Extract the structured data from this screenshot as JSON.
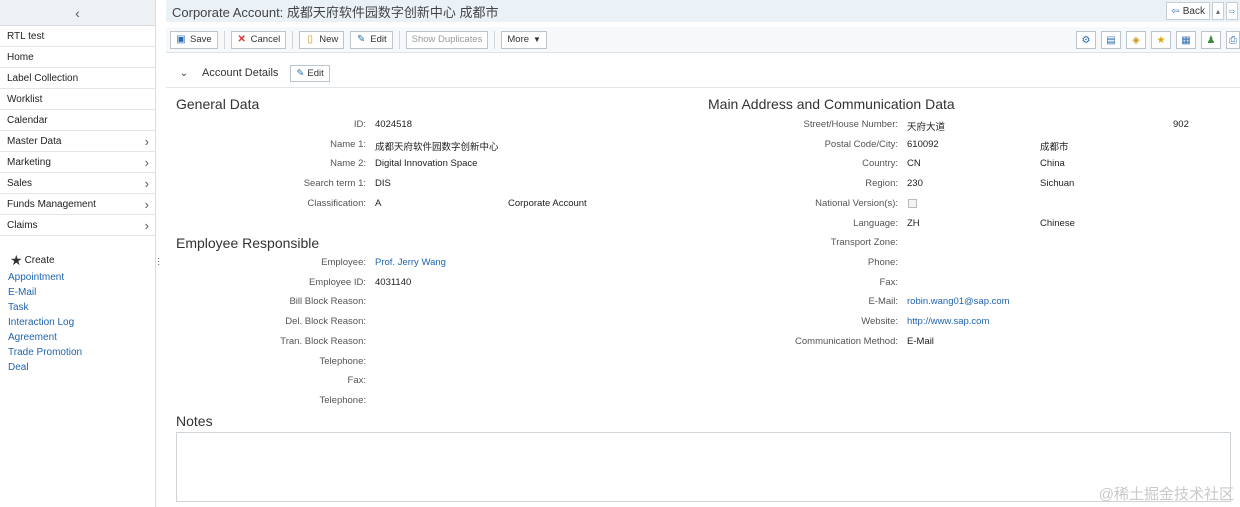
{
  "window": {
    "title": "Corporate Account: 成都天府软件园数字创新中心 成都市",
    "back_label": "Back"
  },
  "sidebar": {
    "items": [
      {
        "label": "RTL test",
        "has_sub": false
      },
      {
        "label": "Home",
        "has_sub": false
      },
      {
        "label": "Label Collection",
        "has_sub": false
      },
      {
        "label": "Worklist",
        "has_sub": false
      },
      {
        "label": "Calendar",
        "has_sub": false
      },
      {
        "label": "Master Data",
        "has_sub": true
      },
      {
        "label": "Marketing",
        "has_sub": true
      },
      {
        "label": "Sales",
        "has_sub": true
      },
      {
        "label": "Funds Management",
        "has_sub": true
      },
      {
        "label": "Claims",
        "has_sub": true
      }
    ],
    "create_label": "Create",
    "create_links": [
      "Appointment",
      "E-Mail",
      "Task",
      "Interaction Log",
      "Agreement",
      "Trade Promotion",
      "Deal"
    ]
  },
  "toolbar": {
    "save": "Save",
    "cancel": "Cancel",
    "new": "New",
    "edit": "Edit",
    "show_duplicates": "Show Duplicates",
    "more": "More"
  },
  "section": {
    "title": "Account Details",
    "edit_label": "Edit"
  },
  "general": {
    "title": "General Data",
    "id_label": "ID:",
    "id": "4024518",
    "name1_label": "Name 1:",
    "name1": "成都天府软件园数字创新中心",
    "name2_label": "Name 2:",
    "name2": "Digital Innovation Space",
    "search_label": "Search term 1:",
    "search": "DIS",
    "class_label": "Classification:",
    "class_code": "A",
    "class_text": "Corporate Account"
  },
  "employee": {
    "title": "Employee Responsible",
    "employee_label": "Employee:",
    "employee": "Prof. Jerry Wang",
    "employee_id_label": "Employee ID:",
    "employee_id": "4031140",
    "bill_block_label": "Bill Block Reason:",
    "del_block_label": "Del. Block Reason:",
    "tran_block_label": "Tran. Block Reason:",
    "telephone_label": "Telephone:",
    "fax_label": "Fax:",
    "telephone2_label": "Telephone:"
  },
  "address": {
    "title": "Main Address and Communication Data",
    "street_label": "Street/House Number:",
    "street": "天府大道",
    "house": "902",
    "postal_label": "Postal Code/City:",
    "postal": "610092",
    "city": "成都市",
    "country_label": "Country:",
    "country_code": "CN",
    "country": "China",
    "region_label": "Region:",
    "region_code": "230",
    "region": "Sichuan",
    "national_label": "National Version(s):",
    "language_label": "Language:",
    "language_code": "ZH",
    "language": "Chinese",
    "transport_label": "Transport Zone:",
    "phone_label": "Phone:",
    "fax_label": "Fax:",
    "email_label": "E-Mail:",
    "email": "robin.wang01@sap.com",
    "website_label": "Website:",
    "website": "http://www.sap.com",
    "comm_label": "Communication Method:",
    "comm": "E-Mail"
  },
  "notes": {
    "title": "Notes"
  },
  "watermark": "@稀土掘金技术社区"
}
